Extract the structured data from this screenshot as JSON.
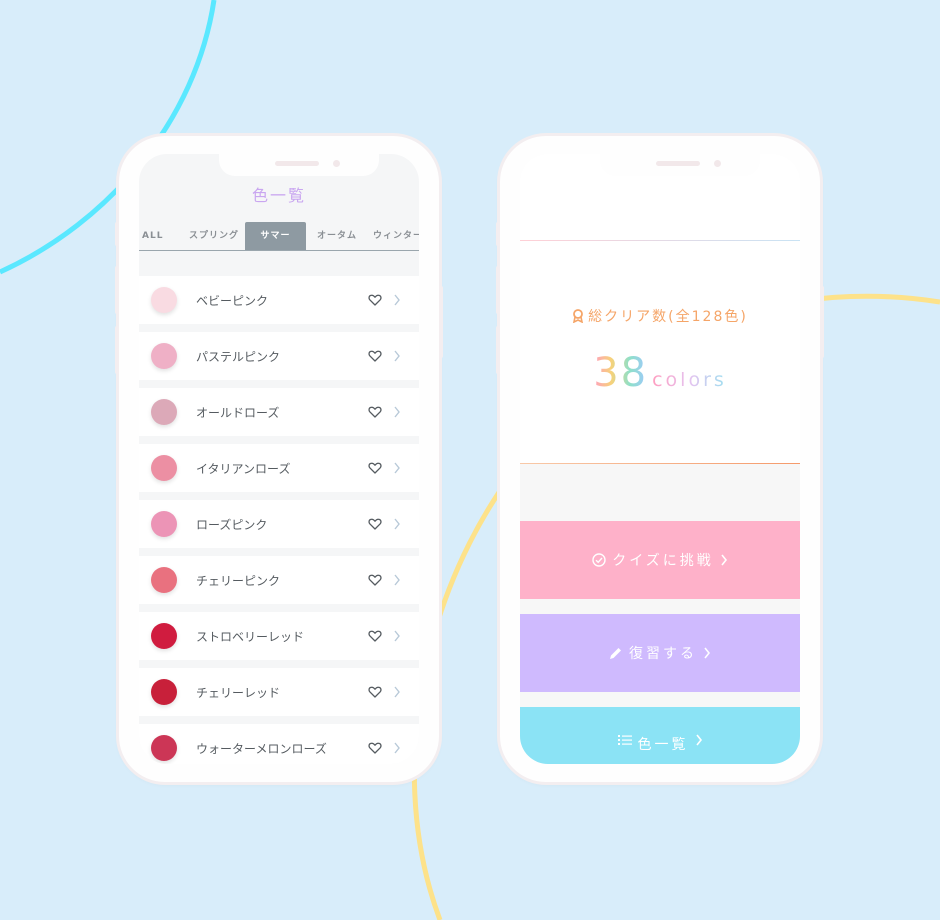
{
  "colors": {
    "background": "#d8edfa",
    "arc_cyan": "#5ae8ff",
    "arc_yellow": "#fde28a",
    "title_purple": "#c9a6f0",
    "active_tab": "#8e9aa2",
    "clear_orange": "#f5a568",
    "quiz_pink": "#feb1c9",
    "review_purple": "#cfbafe",
    "list_cyan": "#8be3f5"
  },
  "left_screen": {
    "title": "色一覧",
    "tabs": [
      {
        "label": "ALL",
        "active": false
      },
      {
        "label": "スプリング",
        "active": false
      },
      {
        "label": "サマー",
        "active": true
      },
      {
        "label": "オータム",
        "active": false
      },
      {
        "label": "ウィンター",
        "active": false
      }
    ],
    "colors": [
      {
        "name": "ベビーピンク",
        "swatch": "#f9dbe2",
        "icon": "heart-outline-icon"
      },
      {
        "name": "パステルピンク",
        "swatch": "#efb0c6",
        "icon": "heart-outline-icon"
      },
      {
        "name": "オールドローズ",
        "swatch": "#dca9b8",
        "icon": "heart-outline-icon"
      },
      {
        "name": "イタリアンローズ",
        "swatch": "#ec8fa3",
        "icon": "heart-outline-icon"
      },
      {
        "name": "ローズピンク",
        "swatch": "#ec94b6",
        "icon": "heart-outline-icon"
      },
      {
        "name": "チェリーピンク",
        "swatch": "#e9717f",
        "icon": "heart-outline-icon"
      },
      {
        "name": "ストロベリーレッド",
        "swatch": "#d01c3f",
        "icon": "heart-outline-icon"
      },
      {
        "name": "チェリーレッド",
        "swatch": "#c8203a",
        "icon": "heart-outline-icon"
      },
      {
        "name": "ウォーターメロンローズ",
        "swatch": "#cc3656",
        "icon": "heart-outline-icon"
      }
    ]
  },
  "right_screen": {
    "clear_label": "総クリア数(全128色)",
    "clear_count": "38",
    "clear_unit": "colors",
    "actions": [
      {
        "label": "クイズに挑戦",
        "icon": "check-circle-icon"
      },
      {
        "label": "復習する",
        "icon": "pencil-icon"
      },
      {
        "label": "色一覧",
        "icon": "list-icon"
      }
    ]
  }
}
